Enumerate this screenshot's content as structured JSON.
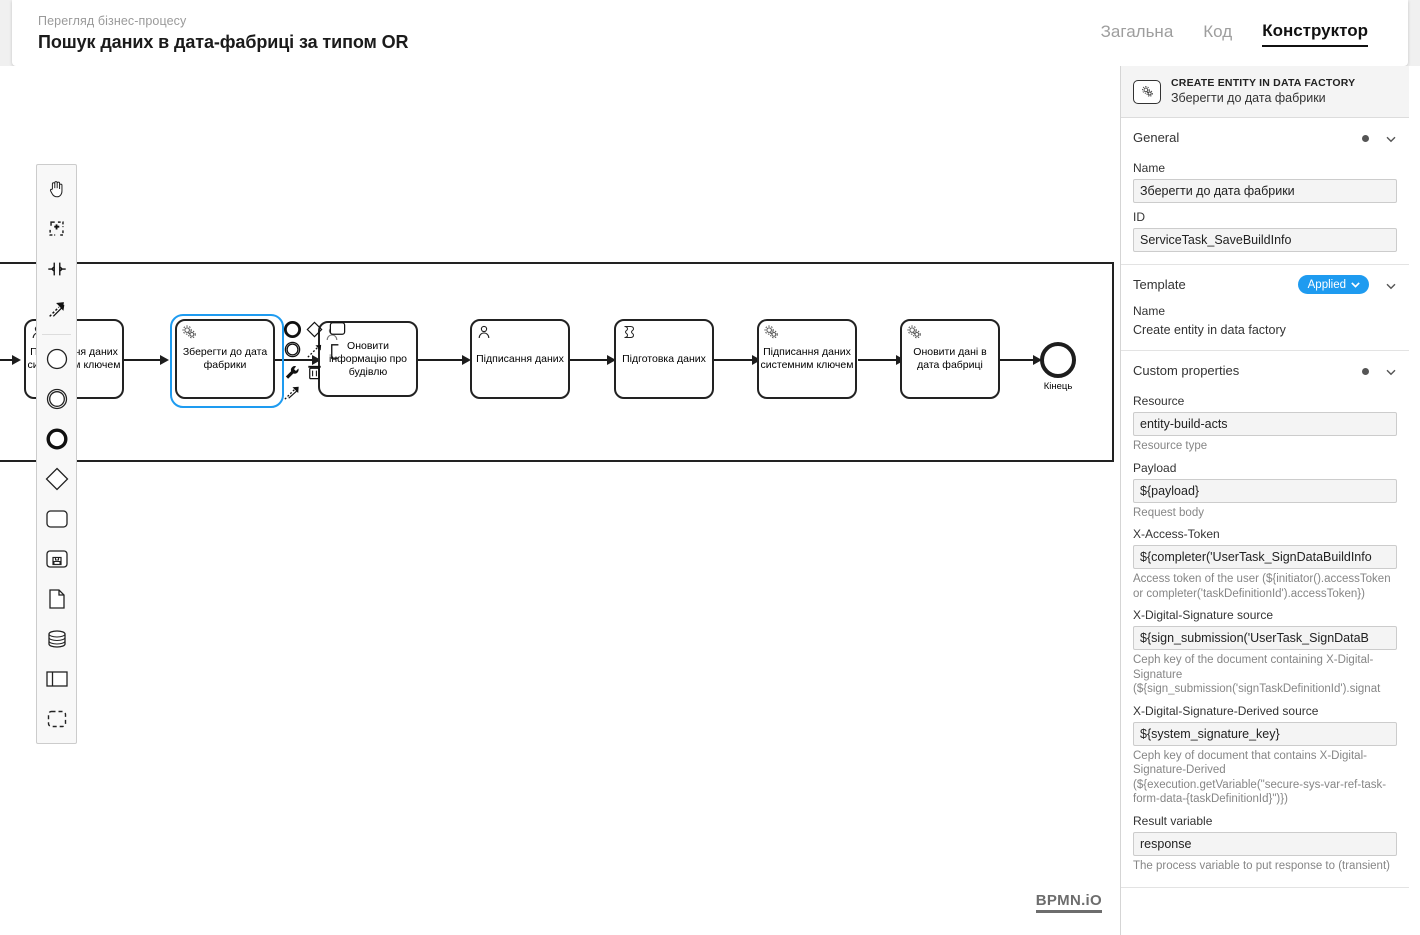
{
  "header": {
    "breadcrumb": "Перегляд бізнес-процесу",
    "title": "Пошук даних в дата-фабриці за типом OR",
    "tabs": [
      {
        "label": "Загальна",
        "active": false
      },
      {
        "label": "Код",
        "active": false
      },
      {
        "label": "Конструктор",
        "active": true
      }
    ]
  },
  "palette": {
    "tools": [
      {
        "name": "hand-tool-icon",
        "title": "Activate the hand tool"
      },
      {
        "name": "lasso-tool-icon",
        "title": "Activate the lasso tool"
      },
      {
        "name": "space-tool-icon",
        "title": "Activate the create/remove space tool"
      },
      {
        "name": "global-connect-tool-icon",
        "title": "Activate the global connect tool"
      },
      {
        "name": "start-event-icon",
        "title": "Create StartEvent"
      },
      {
        "name": "intermediate-event-icon",
        "title": "Create Intermediate/Boundary Event"
      },
      {
        "name": "end-event-icon",
        "title": "Create EndEvent"
      },
      {
        "name": "gateway-icon",
        "title": "Create Gateway"
      },
      {
        "name": "task-icon",
        "title": "Create Task"
      },
      {
        "name": "subprocess-icon",
        "title": "Create expanded SubProcess"
      },
      {
        "name": "data-object-icon",
        "title": "Create DataObjectReference"
      },
      {
        "name": "data-store-icon",
        "title": "Create DataStoreReference"
      },
      {
        "name": "participant-icon",
        "title": "Create Pool/Participant"
      },
      {
        "name": "group-icon",
        "title": "Create Group"
      }
    ]
  },
  "diagram": {
    "watermark": "BPMN.iO",
    "nodes": [
      {
        "id": "usertask_sign_key",
        "label": "Підписання даних системним ключем",
        "type": "user-task",
        "icon": "user-task-icon",
        "partial": true
      },
      {
        "id": "servicetask_savebuildinfo",
        "label": "Зберегти до дата фабрики",
        "type": "service-task",
        "icon": "service-task-icon",
        "selected": true
      },
      {
        "id": "usertask_update_building",
        "label": "Оновити інформацію про будівлю",
        "type": "user-task",
        "icon": "user-task-icon"
      },
      {
        "id": "usertask_signdata",
        "label": "Підписання даних",
        "type": "user-task",
        "icon": "user-task-icon"
      },
      {
        "id": "scripttask_prepare",
        "label": "Підготовка даних",
        "type": "script-task",
        "icon": "script-task-icon"
      },
      {
        "id": "servicetask_signsystem",
        "label": "Підписання даних системним ключем",
        "type": "service-task",
        "icon": "service-task-icon"
      },
      {
        "id": "servicetask_update_df",
        "label": "Оновити дані в дата фабриці",
        "type": "service-task",
        "icon": "service-task-icon"
      },
      {
        "id": "endevent",
        "label": "Кінець",
        "type": "end-event",
        "icon": "end-event-icon"
      }
    ],
    "context_pad": [
      {
        "name": "append-end-event-icon"
      },
      {
        "name": "append-gateway-icon"
      },
      {
        "name": "append-task-icon"
      },
      {
        "name": "append-intermediate-event-icon"
      },
      {
        "name": "append-text-annotation-icon"
      },
      {
        "name": "wrench-icon"
      },
      {
        "name": "delete-icon"
      },
      {
        "name": "connect-icon"
      }
    ]
  },
  "properties": {
    "element_type": "CREATE ENTITY IN DATA FACTORY",
    "element_name": "Зберегти до дата фабрики",
    "groups": [
      {
        "title": "General",
        "fields": [
          {
            "label": "Name",
            "value": "Зберегти до дата фабрики"
          },
          {
            "label": "ID",
            "value": "ServiceTask_SaveBuildInfo"
          }
        ]
      },
      {
        "title": "Template",
        "badge": "Applied",
        "fields": [
          {
            "label": "Name",
            "text": "Create entity in data factory"
          }
        ]
      },
      {
        "title": "Custom properties",
        "fields": [
          {
            "label": "Resource",
            "value": "entity-build-acts",
            "hint": "Resource type"
          },
          {
            "label": "Payload",
            "value": "${payload}",
            "hint": "Request body"
          },
          {
            "label": "X-Access-Token",
            "value": "${completer('UserTask_SignDataBuildInfo",
            "hint": "Access token of the user (${initiator().accessToken or completer('taskDefinitionId').accessToken})"
          },
          {
            "label": "X-Digital-Signature source",
            "value": "${sign_submission('UserTask_SignDataB",
            "hint": "Ceph key of the document containing X-Digital-Signature (${sign_submission('signTaskDefinitionId').signat"
          },
          {
            "label": "X-Digital-Signature-Derived source",
            "value": "${system_signature_key}",
            "hint": "Ceph key of document that contains X-Digital-Signature-Derived (${execution.getVariable(\"secure-sys-var-ref-task-form-data-{taskDefinitionId}\")})"
          },
          {
            "label": "Result variable",
            "value": "response",
            "hint": "The process variable to put response to (transient)"
          }
        ]
      }
    ]
  },
  "colors": {
    "accent_blue": "#1e9bf0",
    "panel_bg": "#ffffff",
    "header_bg": "#f4f4f4",
    "canvas_bg": "#ffffff",
    "body_bg": "#f0f0f0",
    "stroke": "#1d1d1d"
  }
}
